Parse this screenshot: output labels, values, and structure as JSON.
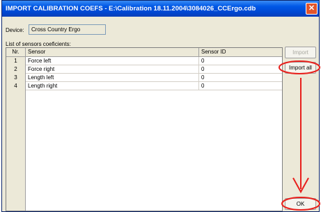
{
  "window": {
    "title": "IMPORT CALIBRATION COEFS - E:\\Calibration 18.11.2004\\3084026_CCErgo.cdb",
    "close_glyph": "✕"
  },
  "device": {
    "label": "Device:",
    "value": "Cross Country Ergo"
  },
  "list": {
    "label": "List of sensors coeficients:",
    "columns": [
      "Nr.",
      "Sensor",
      "Sensor ID"
    ],
    "rows": [
      {
        "nr": "1",
        "sensor": "Force left",
        "id": "0"
      },
      {
        "nr": "2",
        "sensor": "Force right",
        "id": "0"
      },
      {
        "nr": "3",
        "sensor": "Length left",
        "id": "0"
      },
      {
        "nr": "4",
        "sensor": "Length right",
        "id": "0"
      }
    ]
  },
  "buttons": {
    "import": "Import",
    "import_all": "Import all",
    "ok": "OK"
  },
  "annotation": {
    "color": "#e8201c"
  }
}
